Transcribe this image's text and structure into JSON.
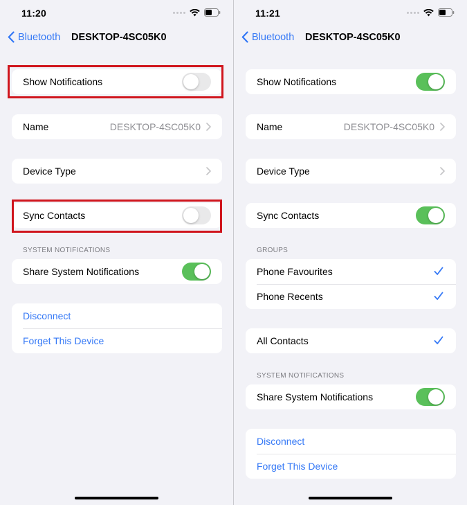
{
  "colors": {
    "accent": "#3478f6",
    "toggle_on": "#5ac05a",
    "highlight": "#d0151d"
  },
  "left": {
    "time": "11:20",
    "back_label": "Bluetooth",
    "title": "DESKTOP-4SC05K0",
    "show_notifications": {
      "label": "Show Notifications",
      "on": false
    },
    "name": {
      "label": "Name",
      "value": "DESKTOP-4SC05K0"
    },
    "device_type": {
      "label": "Device Type"
    },
    "sync_contacts": {
      "label": "Sync Contacts",
      "on": false
    },
    "system_notifications_header": "SYSTEM NOTIFICATIONS",
    "share_system_notifications": {
      "label": "Share System Notifications",
      "on": true
    },
    "disconnect": "Disconnect",
    "forget": "Forget This Device"
  },
  "right": {
    "time": "11:21",
    "back_label": "Bluetooth",
    "title": "DESKTOP-4SC05K0",
    "show_notifications": {
      "label": "Show Notifications",
      "on": true
    },
    "name": {
      "label": "Name",
      "value": "DESKTOP-4SC05K0"
    },
    "device_type": {
      "label": "Device Type"
    },
    "sync_contacts": {
      "label": "Sync Contacts",
      "on": true
    },
    "groups_header": "GROUPS",
    "groups": [
      {
        "label": "Phone Favourites",
        "checked": true
      },
      {
        "label": "Phone Recents",
        "checked": true
      }
    ],
    "all_contacts": {
      "label": "All Contacts",
      "checked": true
    },
    "system_notifications_header": "SYSTEM NOTIFICATIONS",
    "share_system_notifications": {
      "label": "Share System Notifications",
      "on": true
    },
    "disconnect": "Disconnect",
    "forget": "Forget This Device"
  }
}
